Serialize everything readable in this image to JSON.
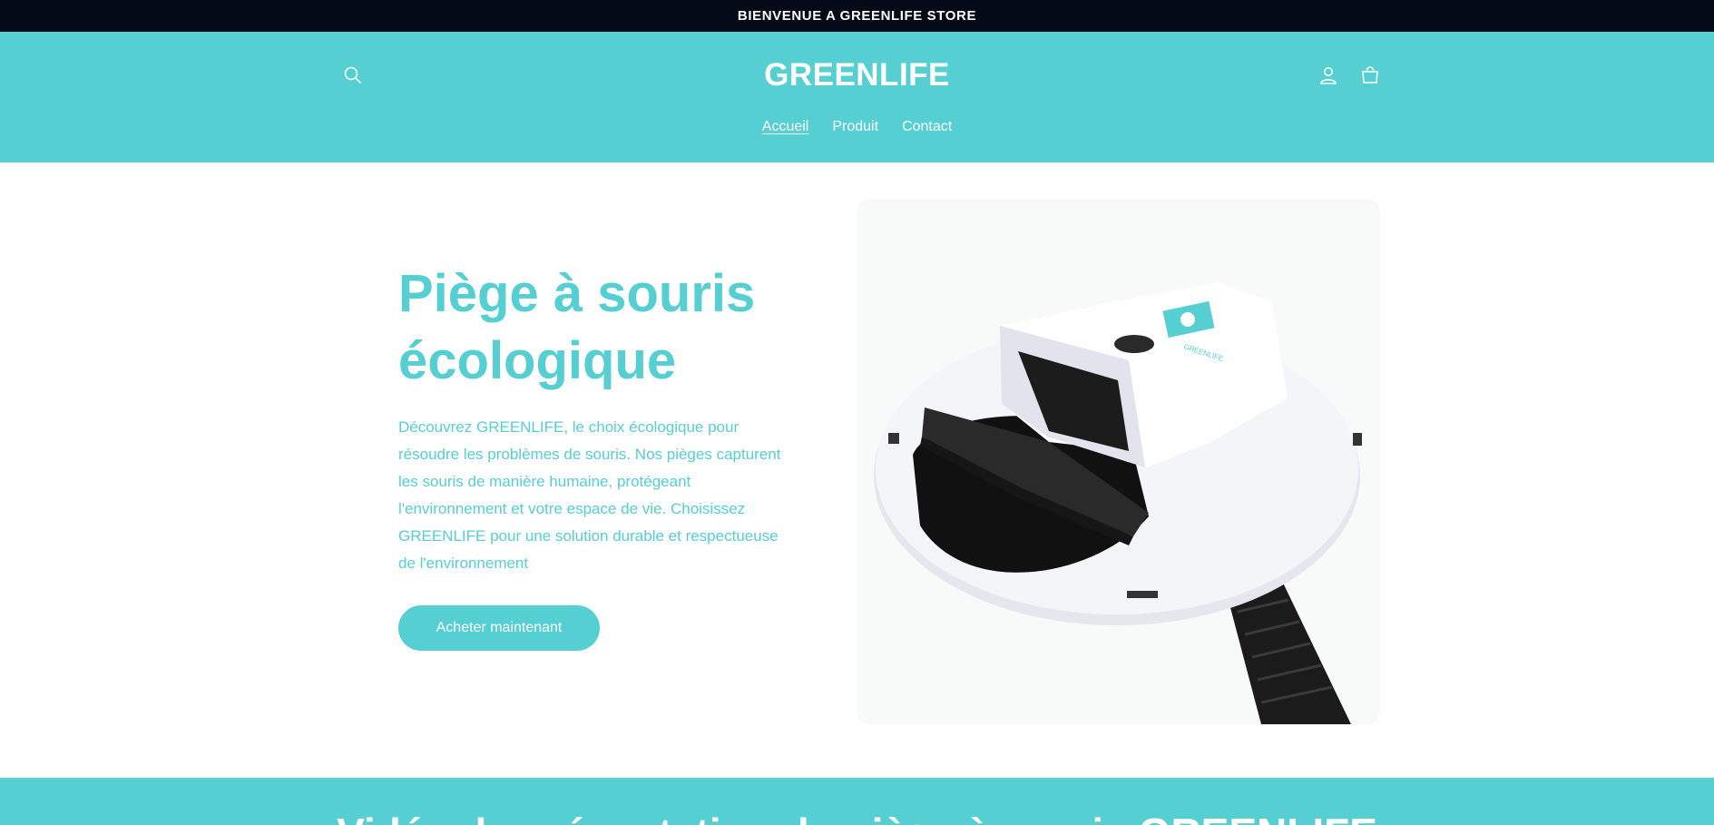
{
  "announcement": {
    "text": "BIENVENUE A GREENLIFE STORE"
  },
  "header": {
    "logo": "GREENLIFE",
    "icons": {
      "search": "search-icon",
      "account": "user-icon",
      "cart": "cart-icon"
    },
    "nav": [
      {
        "label": "Accueil",
        "active": true
      },
      {
        "label": "Produit",
        "active": false
      },
      {
        "label": "Contact",
        "active": false
      }
    ]
  },
  "hero": {
    "title_line1": "Piège à souris",
    "title_line2": "écologique",
    "description": "Découvrez GREENLIFE, le choix écologique pour résoudre les problèmes de souris. Nos pièges capturent les souris de manière humaine, protégeant l'environnement et votre espace de vie. Choisissez GREENLIFE pour une solution durable et respectueuse de l'environnement",
    "cta_label": "Acheter maintenant",
    "image_logo_text": "GREENLIFE"
  },
  "next_section": {
    "title": "Vidéo de présentation du piège à souris GREENLIFE"
  },
  "colors": {
    "brand": "#55cfd2",
    "announcement_bg": "#050a18",
    "text_on_brand": "#ffffff"
  }
}
